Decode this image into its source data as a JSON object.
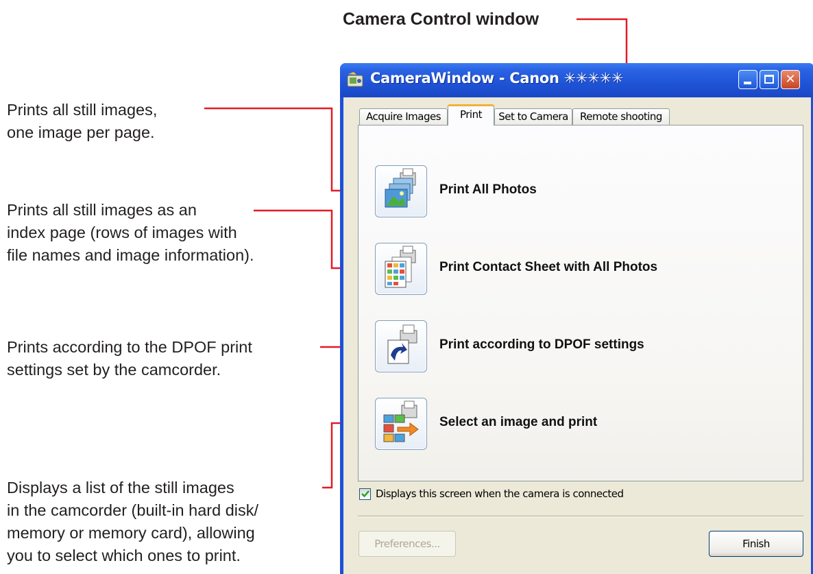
{
  "figure_title": "Camera Control window",
  "notes": [
    {
      "lines": [
        "Prints all still images,",
        "one image per page."
      ]
    },
    {
      "lines": [
        "Prints all still images as an",
        "index page (rows of images with",
        "file names and image information)."
      ]
    },
    {
      "lines": [
        "Prints according to the DPOF print",
        "settings set by the camcorder."
      ]
    },
    {
      "lines": [
        "Displays a list of the still images",
        "in the camcorder (built-in hard disk/",
        "memory or memory card), allowing",
        "you to select which ones to print."
      ]
    }
  ],
  "window": {
    "title": "CameraWindow - Canon ✳✳✳✳✳",
    "tabs": [
      {
        "label": "Acquire Images",
        "active": false
      },
      {
        "label": "Print",
        "active": true
      },
      {
        "label": "Set to Camera",
        "active": false
      },
      {
        "label": "Remote shooting",
        "active": false
      }
    ],
    "actions": [
      {
        "label": "Print All Photos",
        "icon": "print-all-photos-icon"
      },
      {
        "label": "Print Contact Sheet with All Photos",
        "icon": "contact-sheet-icon"
      },
      {
        "label": "Print according to DPOF settings",
        "icon": "dpof-print-icon"
      },
      {
        "label": "Select an image and print",
        "icon": "select-image-print-icon"
      }
    ],
    "checkbox": {
      "label": "Displays this screen when the camera is connected",
      "checked": true
    },
    "buttons": {
      "preferences": "Preferences...",
      "finish": "Finish"
    },
    "colors": {
      "titlebar": "#2a63e3",
      "callout_line": "#e31b23",
      "active_tab_accent": "#f0b13a"
    }
  }
}
